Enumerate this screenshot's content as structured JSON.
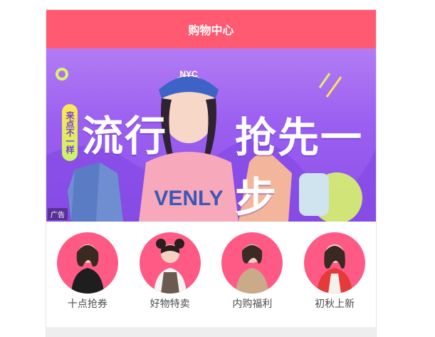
{
  "header": {
    "title": "购物中心"
  },
  "banner": {
    "tag": "来点不一样",
    "slogan_left": "流行",
    "slogan_right": "抢先一步",
    "cap_text": "NYC",
    "shirt_text": "VENLY",
    "ad_label": "广告"
  },
  "categories": [
    {
      "label": "十点抢券",
      "icon": "woman-portrait-icon"
    },
    {
      "label": "好物特卖",
      "icon": "woman-portrait-icon"
    },
    {
      "label": "内购福利",
      "icon": "woman-portrait-icon"
    },
    {
      "label": "初秋上新",
      "icon": "woman-portrait-icon"
    }
  ],
  "colors": {
    "header_bg": "#ff5a72",
    "banner_purple": "#9a5ef0",
    "circle_pink": "#ff5a86"
  }
}
